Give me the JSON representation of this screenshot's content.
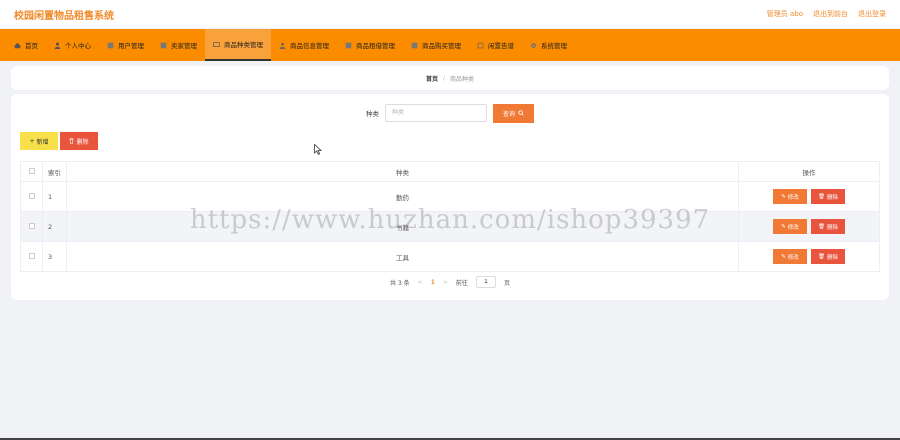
{
  "header": {
    "title": "校园闲置物品租售系统",
    "user_label": "管理员 abo",
    "back_label": "退出到前台",
    "logout_label": "退出登录"
  },
  "nav": [
    {
      "label": "首页",
      "icon": "home-icon"
    },
    {
      "label": "个人中心",
      "icon": "user-icon"
    },
    {
      "label": "用户管理",
      "icon": "users-icon"
    },
    {
      "label": "卖家管理",
      "icon": "seller-icon"
    },
    {
      "label": "商品种类管理",
      "icon": "category-icon"
    },
    {
      "label": "商品信息管理",
      "icon": "goods-icon"
    },
    {
      "label": "商品租借管理",
      "icon": "rent-icon"
    },
    {
      "label": "商品购买管理",
      "icon": "cart-icon"
    },
    {
      "label": "闲置告谱",
      "icon": "notice-icon"
    },
    {
      "label": "系统管理",
      "icon": "settings-icon"
    }
  ],
  "breadcrumb": {
    "home": "首页",
    "separator": "/",
    "current": "商品种类"
  },
  "search": {
    "label": "种类",
    "placeholder": "种类",
    "value": "",
    "button_label": "查询"
  },
  "actions": {
    "add_label": "新增",
    "delete_label": "删除"
  },
  "table": {
    "headers": {
      "index": "索引",
      "kind": "种类",
      "ops": "操作"
    },
    "rows": [
      {
        "index": "1",
        "kind": "勤药"
      },
      {
        "index": "2",
        "kind": "书籍"
      },
      {
        "index": "3",
        "kind": "工具"
      }
    ],
    "edit_label": "修改",
    "row_delete_label": "删除"
  },
  "pagination": {
    "total_text": "共 3 条",
    "prev": "<",
    "current_page": "1",
    "next": ">",
    "goto_label": "前往",
    "goto_value": "1",
    "page_unit": "页"
  },
  "watermark": "https://www.huzhan.com/ishop39397",
  "colors": {
    "brand": "#f08a2a",
    "nav_bg": "#fb8c00",
    "nav_active": "#f9a13a",
    "danger": "#e8543c",
    "warning": "#f7e04a",
    "primary_btn": "#f07a35"
  }
}
